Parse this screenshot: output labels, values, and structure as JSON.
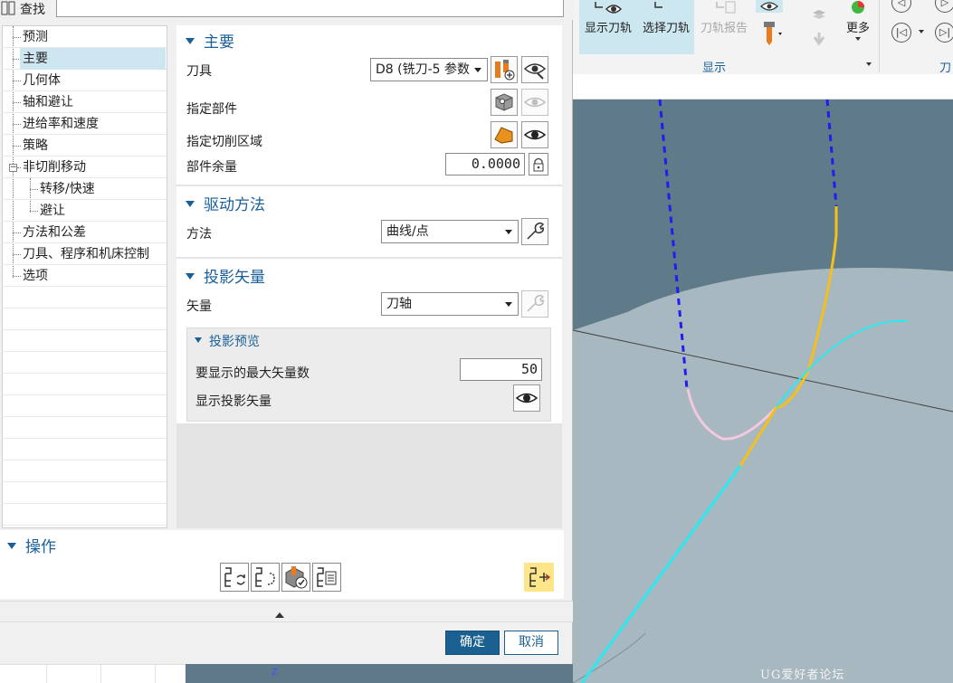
{
  "find": {
    "label": "查找",
    "value": ""
  },
  "tree": {
    "items": [
      {
        "label": "预测",
        "level": 0
      },
      {
        "label": "主要",
        "level": 0,
        "selected": true
      },
      {
        "label": "几何体",
        "level": 0
      },
      {
        "label": "轴和避让",
        "level": 0
      },
      {
        "label": "进给率和速度",
        "level": 0
      },
      {
        "label": "策略",
        "level": 0
      },
      {
        "label": "非切削移动",
        "level": 0,
        "expanded": true
      },
      {
        "label": "转移/快速",
        "level": 1
      },
      {
        "label": "避让",
        "level": 1
      },
      {
        "label": "方法和公差",
        "level": 0
      },
      {
        "label": "刀具、程序和机床控制",
        "level": 0
      },
      {
        "label": "选项",
        "level": 0
      }
    ]
  },
  "main": {
    "title": "主要",
    "tool_label": "刀具",
    "tool_value": "D8 (铣刀-5 参数",
    "part_label": "指定部件",
    "cut_area_label": "指定切削区域",
    "stock_label": "部件余量",
    "stock_value": "0.0000"
  },
  "drive": {
    "title": "驱动方法",
    "method_label": "方法",
    "method_value": "曲线/点"
  },
  "projection": {
    "title": "投影矢量",
    "vector_label": "矢量",
    "vector_value": "刀轴",
    "preview": {
      "title": "投影预览",
      "max_label": "要显示的最大矢量数",
      "max_value": "50",
      "show_label": "显示投影矢量"
    }
  },
  "operations": {
    "title": "操作"
  },
  "buttons": {
    "ok": "确定",
    "cancel": "取消"
  },
  "ribbon": {
    "show_path": "显示刀轨",
    "select_path": "选择刀轨",
    "path_report": "刀轨报告",
    "more": "更多",
    "group_label": "显示",
    "next_group": "刀"
  },
  "viewport": {
    "watermark": "UG爱好者论坛 WWW.UGSNX.COM",
    "axis": "Z",
    "colors": {
      "surface": "#a8b8c0",
      "background": "#5f7a88",
      "path_rapid": "#1e1ef0",
      "path_cut": "#f4c01e",
      "path_engage": "#f4c8e0",
      "curve": "#2ee8f0"
    }
  }
}
